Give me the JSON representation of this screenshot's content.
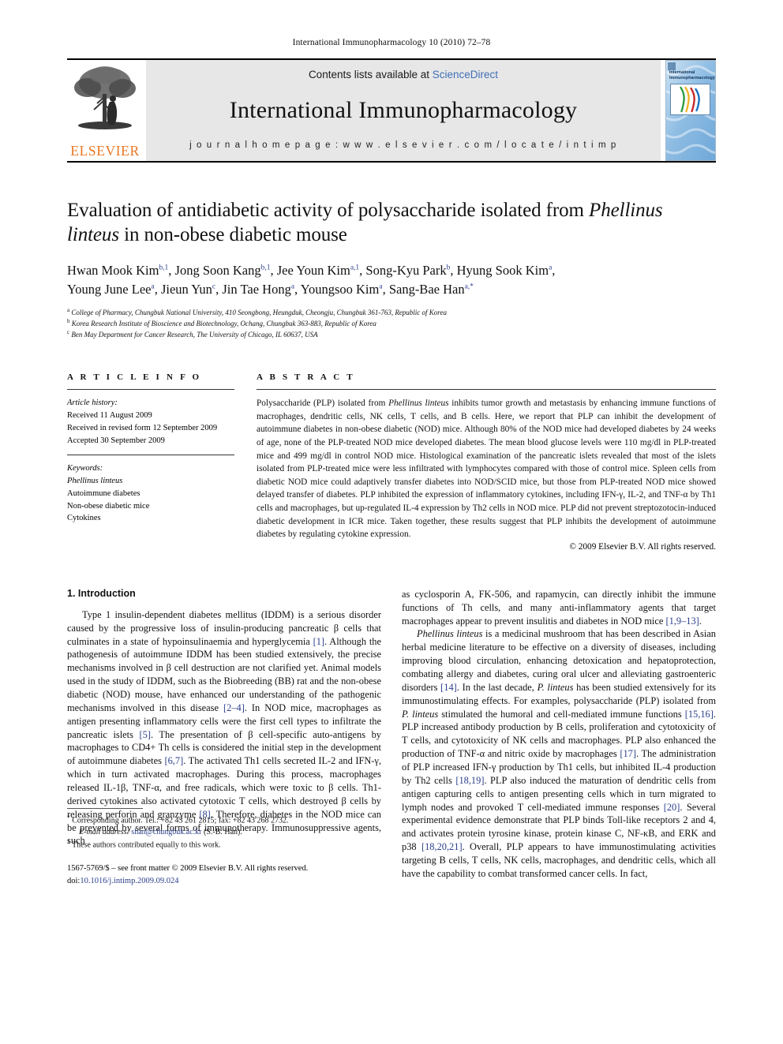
{
  "running_head": "International Immunopharmacology 10 (2010) 72–78",
  "masthead": {
    "publisher_name": "ELSEVIER",
    "contents_prefix": "Contents lists available at ",
    "contents_link": "ScienceDirect",
    "journal_title": "International Immunopharmacology",
    "homepage": "j o u r n a l   h o m e p a g e :   w w w . e l s e v i e r . c o m / l o c a t e / i n t i m p",
    "cover_title_line1": "International",
    "cover_title_line2": "Immunopharmacology"
  },
  "article": {
    "title_part1": "Evaluation of antidiabetic activity of polysaccharide isolated from ",
    "title_italic": "Phellinus linteus",
    "title_part2": " in non-obese diabetic mouse",
    "authors_line1": "Hwan Mook Kim b,1, Jong Soon Kang b,1, Jee Youn Kim a,1, Song-Kyu Park b, Hyung Sook Kim a,",
    "authors_line2": "Young June Lee a, Jieun Yun c, Jin Tae Hong a, Youngsoo Kim a, Sang-Bae Han a,*",
    "authors": [
      {
        "name": "Hwan Mook Kim",
        "sup": "b,1"
      },
      {
        "name": "Jong Soon Kang",
        "sup": "b,1"
      },
      {
        "name": "Jee Youn Kim",
        "sup": "a,1"
      },
      {
        "name": "Song-Kyu Park",
        "sup": "b"
      },
      {
        "name": "Hyung Sook Kim",
        "sup": "a"
      },
      {
        "name": "Young June Lee",
        "sup": "a"
      },
      {
        "name": "Jieun Yun",
        "sup": "c"
      },
      {
        "name": "Jin Tae Hong",
        "sup": "a"
      },
      {
        "name": "Youngsoo Kim",
        "sup": "a"
      },
      {
        "name": "Sang-Bae Han",
        "sup": "a,*"
      }
    ],
    "affiliations": [
      {
        "mark": "a",
        "text": "College of Pharmacy, Chungbuk National University, 410 Seongbong, Heungduk, Cheongju, Chungbuk 361-763, Republic of Korea"
      },
      {
        "mark": "b",
        "text": "Korea Research Institute of Bioscience and Biotechnology, Ochang, Chungbuk 363-883, Republic of Korea"
      },
      {
        "mark": "c",
        "text": "Ben May Department for Cancer Research, The University of Chicago, IL 60637, USA"
      }
    ]
  },
  "article_info": {
    "label": "A R T I C L E    I N F O",
    "history_label": "Article history:",
    "history": [
      "Received 11 August 2009",
      "Received in revised form 12 September 2009",
      "Accepted 30 September 2009"
    ],
    "keywords_label": "Keywords:",
    "keywords": [
      "Phellinus linteus",
      "Autoimmune diabetes",
      "Non-obese diabetic mice",
      "Cytokines"
    ]
  },
  "abstract": {
    "label": "A B S T R A C T",
    "text_a": "Polysaccharide (PLP) isolated from ",
    "text_italic": "Phellinus linteus",
    "text_b": " inhibits tumor growth and metastasis by enhancing immune functions of macrophages, dendritic cells, NK cells, T cells, and B cells. Here, we report that PLP can inhibit the development of autoimmune diabetes in non-obese diabetic (NOD) mice. Although 80% of the NOD mice had developed diabetes by 24 weeks of age, none of the PLP-treated NOD mice developed diabetes. The mean blood glucose levels were 110 mg/dl in PLP-treated mice and 499 mg/dl in control NOD mice. Histological examination of the pancreatic islets revealed that most of the islets isolated from PLP-treated mice were less infiltrated with lymphocytes compared with those of control mice. Spleen cells from diabetic NOD mice could adaptively transfer diabetes into NOD/SCID mice, but those from PLP-treated NOD mice showed delayed transfer of diabetes. PLP inhibited the expression of inflammatory cytokines, including IFN-γ, IL-2, and TNF-α by Th1 cells and macrophages, but up-regulated IL-4 expression by Th2 cells in NOD mice. PLP did not prevent streptozotocin-induced diabetic development in ICR mice. Taken together, these results suggest that PLP inhibits the development of autoimmune diabetes by regulating cytokine expression.",
    "copyright": "© 2009 Elsevier B.V. All rights reserved."
  },
  "body": {
    "section_heading": "1. Introduction",
    "left_p1_a": "Type 1 insulin-dependent diabetes mellitus (IDDM) is a serious disorder caused by the progressive loss of insulin-producing pancreatic β cells that culminates in a state of hypoinsulinaemia and hyperglycemia ",
    "left_p1_r1": "[1]",
    "left_p1_b": ". Although the pathogenesis of autoimmune IDDM has been studied extensively, the precise mechanisms involved in β cell destruction are not clarified yet. Animal models used in the study of IDDM, such as the Biobreeding (BB) rat and the non-obese diabetic (NOD) mouse, have enhanced our understanding of the pathogenic mechanisms involved in this disease ",
    "left_p1_r2": "[2–4]",
    "left_p1_c": ". In NOD mice, macrophages as antigen presenting inflammatory cells were the first cell types to infiltrate the pancreatic islets ",
    "left_p1_r3": "[5]",
    "left_p1_d": ". The presentation of β cell-specific auto-antigens by macrophages to CD4+ Th cells is considered the initial step in the development of autoimmune diabetes ",
    "left_p1_r4": "[6,7]",
    "left_p1_e": ". The activated Th1 cells secreted IL-2 and IFN-γ, which in turn activated macrophages. During this process, macrophages released IL-1β, TNF-α, and free radicals, which were toxic to β cells. Th1-derived cytokines also activated cytotoxic T cells, which destroyed β cells by releasing perforin and granzyme ",
    "left_p1_r5": "[8]",
    "left_p1_f": ". Therefore, diabetes in the NOD mice can be prevented by several forms of immunotherapy. Immunosuppressive agents, such",
    "right_p1_a": "as cyclosporin A, FK-506, and rapamycin, can directly inhibit the immune functions of Th cells, and many anti-inflammatory agents that target macrophages appear to prevent insulitis and diabetes in NOD mice ",
    "right_p1_r1": "[1,9–13]",
    "right_p1_b": ".",
    "right_p2_italic1": "Phellinus linteus",
    "right_p2_a": " is a medicinal mushroom that has been described in Asian herbal medicine literature to be effective on a diversity of diseases, including improving blood circulation, enhancing detoxication and hepatoprotection, combating allergy and diabetes, curing oral ulcer and alleviating gastroenteric disorders ",
    "right_p2_r1": "[14]",
    "right_p2_b": ". In the last decade, ",
    "right_p2_italic2": "P. linteus",
    "right_p2_c": " has been studied extensively for its immunostimulating effects. For examples, polysaccharide (PLP) isolated from ",
    "right_p2_italic3": "P. linteus",
    "right_p2_d": " stimulated the humoral and cell-mediated immune functions ",
    "right_p2_r2": "[15,16]",
    "right_p2_e": ". PLP increased antibody production by B cells, proliferation and cytotoxicity of T cells, and cytotoxicity of NK cells and macrophages. PLP also enhanced the production of TNF-α and nitric oxide by macrophages ",
    "right_p2_r3": "[17]",
    "right_p2_f": ". The administration of PLP increased IFN-γ production by Th1 cells, but inhibited IL-4 production by Th2 cells ",
    "right_p2_r4": "[18,19]",
    "right_p2_g": ". PLP also induced the maturation of dendritic cells from antigen capturing cells to antigen presenting cells which in turn migrated to lymph nodes and provoked T cell-mediated immune responses ",
    "right_p2_r5": "[20]",
    "right_p2_h": ". Several experimental evidence demonstrate that PLP binds Toll-like receptors 2 and 4, and activates protein tyrosine kinase, protein kinase C, NF-κB, and ERK and p38 ",
    "right_p2_r6": "[18,20,21]",
    "right_p2_i": ". Overall, PLP appears to have immunostimulating activities targeting B cells, T cells, NK cells, macrophages, and dendritic cells, which all have the capability to combat transformed cancer cells. In fact,"
  },
  "footnotes": {
    "corresponding": "Corresponding author. Tel.: +82 43 261 2815; fax: +82 43 268 2732.",
    "email_label": "E-mail address:",
    "email": "shan@chungbuk.ac.kr",
    "email_suffix": "(S.-B. Han).",
    "equal_contrib": "These authors contributed equally to this work.",
    "imprint": "1567-5769/$ – see front matter © 2009 Elsevier B.V. All rights reserved.",
    "doi_label": "doi:",
    "doi": "10.1016/j.intimp.2009.09.024"
  },
  "colors": {
    "elsevier_orange": "#E87722",
    "link_blue": "#3f6fb5",
    "reference_blue": "#2b3f8c",
    "panel_grey": "#e7e7e8"
  }
}
